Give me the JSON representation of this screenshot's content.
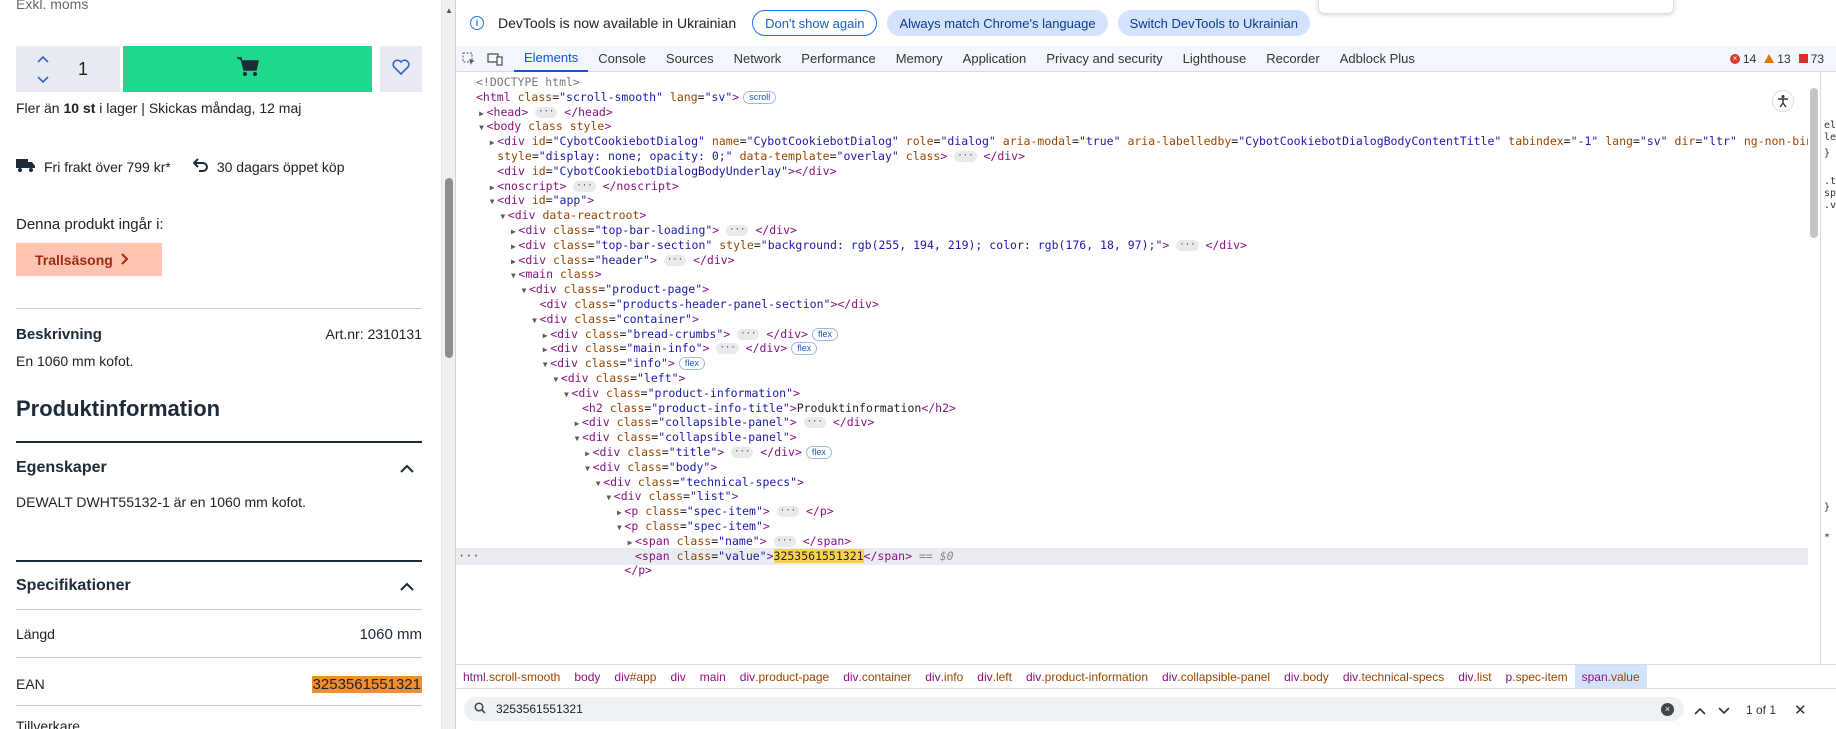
{
  "page": {
    "price_note": "Exkl. moms",
    "quantity": "1",
    "stock_count": "10 st",
    "stock_prefix": "Fler än ",
    "stock_suffix": " i lager | Skickas måndag, 12 maj",
    "perks": [
      "Fri frakt över 799 kr*",
      "30 dagars öppet köp"
    ],
    "included_in_label": "Denna produkt ingår i:",
    "campaign_tag": "Trallsäsong",
    "description_title": "Beskrivning",
    "article_number": "Art.nr: 2310131",
    "description_text": "En 1060 mm kofot.",
    "product_info_title": "Produktinformation",
    "properties_title": "Egenskaper",
    "properties_text": "DEWALT DWHT55132-1 är en 1060 mm kofot.",
    "specs_title": "Specifikationer",
    "specs": [
      {
        "name": "Längd",
        "value": "1060 mm"
      },
      {
        "name": "EAN",
        "value": "3253561551321"
      }
    ],
    "next_spec_name": "Tillverkare",
    "colors": {
      "cart": "#1ed88e",
      "tag_bg": "#ffc4b0",
      "ean_highlight": "#f28d32"
    }
  },
  "devtools": {
    "infobar": {
      "message": "DevTools is now available in Ukrainian",
      "dont_show": "Don't show again",
      "match_lang": "Always match Chrome's language",
      "switch": "Switch DevTools to Ukrainian"
    },
    "tabs": [
      "Elements",
      "Console",
      "Sources",
      "Network",
      "Performance",
      "Memory",
      "Application",
      "Privacy and security",
      "Lighthouse",
      "Recorder",
      "Adblock Plus"
    ],
    "active_tab": "Elements",
    "counts": {
      "errors": "14",
      "warnings": "13",
      "issues": "73"
    },
    "breadcrumbs": [
      {
        "name": "html",
        "attr": ".scroll-smooth"
      },
      {
        "name": "body",
        "attr": ""
      },
      {
        "name": "div",
        "attr": "#app"
      },
      {
        "name": "div",
        "attr": ""
      },
      {
        "name": "main",
        "attr": ""
      },
      {
        "name": "div",
        "attr": ".product-page"
      },
      {
        "name": "div",
        "attr": ".container"
      },
      {
        "name": "div",
        "attr": ".info"
      },
      {
        "name": "div",
        "attr": ".left"
      },
      {
        "name": "div",
        "attr": ".product-information"
      },
      {
        "name": "div",
        "attr": ".collapsible-panel"
      },
      {
        "name": "div",
        "attr": ".body"
      },
      {
        "name": "div",
        "attr": ".technical-specs"
      },
      {
        "name": "div",
        "attr": ".list"
      },
      {
        "name": "p",
        "attr": ".spec-item"
      },
      {
        "name": "span",
        "attr": ".value"
      }
    ],
    "search": {
      "query": "3253561551321",
      "result": "1 of 1"
    },
    "side_panel_text": [
      "el",
      "le",
      "}",
      ".t",
      "sp",
      ".v",
      "}",
      "*"
    ],
    "dom_lines": [
      {
        "d": 0,
        "tw": "",
        "html": "<span class='cm'>&lt;!DOCTYPE html&gt;</span>"
      },
      {
        "d": 0,
        "tw": "",
        "html": "<span class='t'>&lt;html</span> <span class='an'>class</span>=<span class='av'>\"scroll-smooth\"</span> <span class='an'>lang</span>=<span class='av'>\"sv\"</span><span class='t'>&gt;</span><span class='badge'>scroll</span>"
      },
      {
        "d": 1,
        "tw": "▶",
        "html": "<span class='t'>&lt;head&gt;</span> <span class='dots'>···</span> <span class='t'>&lt;/head&gt;</span>"
      },
      {
        "d": 1,
        "tw": "▼",
        "html": "<span class='t'>&lt;body</span> <span class='an'>class style</span><span class='t'>&gt;</span>"
      },
      {
        "d": 2,
        "tw": "▶",
        "html": "<span class='t'>&lt;div</span> <span class='an'>id</span>=<span class='av'>\"CybotCookiebotDialog\"</span> <span class='an'>name</span>=<span class='av'>\"CybotCookiebotDialog\"</span> <span class='an'>role</span>=<span class='av'>\"dialog\"</span> <span class='an'>aria-modal</span>=<span class='av'>\"true\"</span> <span class='an'>aria-labelledby</span>=<span class='av'>\"CybotCookiebotDialogBodyContentTitle\"</span> <span class='an'>tabindex</span>=<span class='av'>\"-1\"</span> <span class='an'>lang</span>=<span class='av'>\"sv\"</span> <span class='an'>dir</span>=<span class='av'>\"ltr\"</span> <span class='an'>ng-non-bindable</span>"
      },
      {
        "d": 2,
        "tw": "",
        "html": "<span class='an'>style</span>=<span class='av'>\"display: none; opacity: 0;\"</span> <span class='an'>data-template</span>=<span class='av'>\"overlay\"</span> <span class='an'>class</span><span class='t'>&gt;</span> <span class='dots'>···</span> <span class='t'>&lt;/div&gt;</span>"
      },
      {
        "d": 2,
        "tw": "",
        "html": "<span class='t'>&lt;div</span> <span class='an'>id</span>=<span class='av'>\"CybotCookiebotDialogBodyUnderlay\"</span><span class='t'>&gt;&lt;/div&gt;</span>"
      },
      {
        "d": 2,
        "tw": "▶",
        "html": "<span class='t'>&lt;noscript&gt;</span> <span class='dots'>···</span> <span class='t'>&lt;/noscript&gt;</span>"
      },
      {
        "d": 2,
        "tw": "▼",
        "html": "<span class='t'>&lt;div</span> <span class='an'>id</span>=<span class='av'>\"app\"</span><span class='t'>&gt;</span>"
      },
      {
        "d": 3,
        "tw": "▼",
        "html": "<span class='t'>&lt;div</span> <span class='an'>data-reactroot</span><span class='t'>&gt;</span>"
      },
      {
        "d": 4,
        "tw": "▶",
        "html": "<span class='t'>&lt;div</span> <span class='an'>class</span>=<span class='av'>\"top-bar-loading\"</span><span class='t'>&gt;</span> <span class='dots'>···</span> <span class='t'>&lt;/div&gt;</span>"
      },
      {
        "d": 4,
        "tw": "▶",
        "html": "<span class='t'>&lt;div</span> <span class='an'>class</span>=<span class='av'>\"top-bar-section\"</span> <span class='an'>style</span>=<span class='av'>\"background: rgb(255, 194, 219); color: rgb(176, 18, 97);\"</span><span class='t'>&gt;</span> <span class='dots'>···</span> <span class='t'>&lt;/div&gt;</span>"
      },
      {
        "d": 4,
        "tw": "▶",
        "html": "<span class='t'>&lt;div</span> <span class='an'>class</span>=<span class='av'>\"header\"</span><span class='t'>&gt;</span> <span class='dots'>···</span> <span class='t'>&lt;/div&gt;</span>"
      },
      {
        "d": 4,
        "tw": "▼",
        "html": "<span class='t'>&lt;main</span> <span class='an'>class</span><span class='t'>&gt;</span>"
      },
      {
        "d": 5,
        "tw": "▼",
        "html": "<span class='t'>&lt;div</span> <span class='an'>class</span>=<span class='av'>\"product-page\"</span><span class='t'>&gt;</span>"
      },
      {
        "d": 6,
        "tw": "",
        "html": "<span class='t'>&lt;div</span> <span class='an'>class</span>=<span class='av'>\"products-header-panel-section\"</span><span class='t'>&gt;&lt;/div&gt;</span>"
      },
      {
        "d": 6,
        "tw": "▼",
        "html": "<span class='t'>&lt;div</span> <span class='an'>class</span>=<span class='av'>\"container\"</span><span class='t'>&gt;</span>"
      },
      {
        "d": 7,
        "tw": "▶",
        "html": "<span class='t'>&lt;div</span> <span class='an'>class</span>=<span class='av'>\"bread-crumbs\"</span><span class='t'>&gt;</span> <span class='dots'>···</span> <span class='t'>&lt;/div&gt;</span><span class='badge'>flex</span>"
      },
      {
        "d": 7,
        "tw": "▶",
        "html": "<span class='t'>&lt;div</span> <span class='an'>class</span>=<span class='av'>\"main-info\"</span><span class='t'>&gt;</span> <span class='dots'>···</span> <span class='t'>&lt;/div&gt;</span><span class='badge'>flex</span>"
      },
      {
        "d": 7,
        "tw": "▼",
        "html": "<span class='t'>&lt;div</span> <span class='an'>class</span>=<span class='av'>\"info\"</span><span class='t'>&gt;</span><span class='badge'>flex</span>"
      },
      {
        "d": 8,
        "tw": "▼",
        "html": "<span class='t'>&lt;div</span> <span class='an'>class</span>=<span class='av'>\"left\"</span><span class='t'>&gt;</span>"
      },
      {
        "d": 9,
        "tw": "▼",
        "html": "<span class='t'>&lt;div</span> <span class='an'>class</span>=<span class='av'>\"product-information\"</span><span class='t'>&gt;</span>"
      },
      {
        "d": 10,
        "tw": "",
        "html": "<span class='t'>&lt;h2</span> <span class='an'>class</span>=<span class='av'>\"product-info-title\"</span><span class='t'>&gt;</span><span class='tx'>Produktinformation</span><span class='t'>&lt;/h2&gt;</span>"
      },
      {
        "d": 10,
        "tw": "▶",
        "html": "<span class='t'>&lt;div</span> <span class='an'>class</span>=<span class='av'>\"collapsible-panel\"</span><span class='t'>&gt;</span> <span class='dots'>···</span> <span class='t'>&lt;/div&gt;</span>"
      },
      {
        "d": 10,
        "tw": "▼",
        "html": "<span class='t'>&lt;div</span> <span class='an'>class</span>=<span class='av'>\"collapsible-panel\"</span><span class='t'>&gt;</span>"
      },
      {
        "d": 11,
        "tw": "▶",
        "html": "<span class='t'>&lt;div</span> <span class='an'>class</span>=<span class='av'>\"title\"</span><span class='t'>&gt;</span> <span class='dots'>···</span> <span class='t'>&lt;/div&gt;</span><span class='badge'>flex</span>"
      },
      {
        "d": 11,
        "tw": "▼",
        "html": "<span class='t'>&lt;div</span> <span class='an'>class</span>=<span class='av'>\"body\"</span><span class='t'>&gt;</span>"
      },
      {
        "d": 12,
        "tw": "▼",
        "html": "<span class='t'>&lt;div</span> <span class='an'>class</span>=<span class='av'>\"technical-specs\"</span><span class='t'>&gt;</span>"
      },
      {
        "d": 13,
        "tw": "▼",
        "html": "<span class='t'>&lt;div</span> <span class='an'>class</span>=<span class='av'>\"list\"</span><span class='t'>&gt;</span>"
      },
      {
        "d": 14,
        "tw": "▶",
        "html": "<span class='t'>&lt;p</span> <span class='an'>class</span>=<span class='av'>\"spec-item\"</span><span class='t'>&gt;</span> <span class='dots'>···</span> <span class='t'>&lt;/p&gt;</span>"
      },
      {
        "d": 14,
        "tw": "▼",
        "html": "<span class='t'>&lt;p</span> <span class='an'>class</span>=<span class='av'>\"spec-item\"</span><span class='t'>&gt;</span>"
      },
      {
        "d": 15,
        "tw": "▶",
        "html": "<span class='t'>&lt;span</span> <span class='an'>class</span>=<span class='av'>\"name\"</span><span class='t'>&gt;</span> <span class='dots'>···</span> <span class='t'>&lt;/span&gt;</span>"
      },
      {
        "d": 15,
        "tw": "",
        "sel": true,
        "html": "<span class='t'>&lt;span</span> <span class='an'>class</span>=<span class='av'>\"value\"</span><span class='t'>&gt;</span><span class='hl'>3253561551321</span><span class='t'>&lt;/span&gt;</span> <span class='eqs'>== $0</span>"
      },
      {
        "d": 14,
        "tw": "",
        "html": "<span class='t'>&lt;/p&gt;</span>"
      }
    ]
  }
}
